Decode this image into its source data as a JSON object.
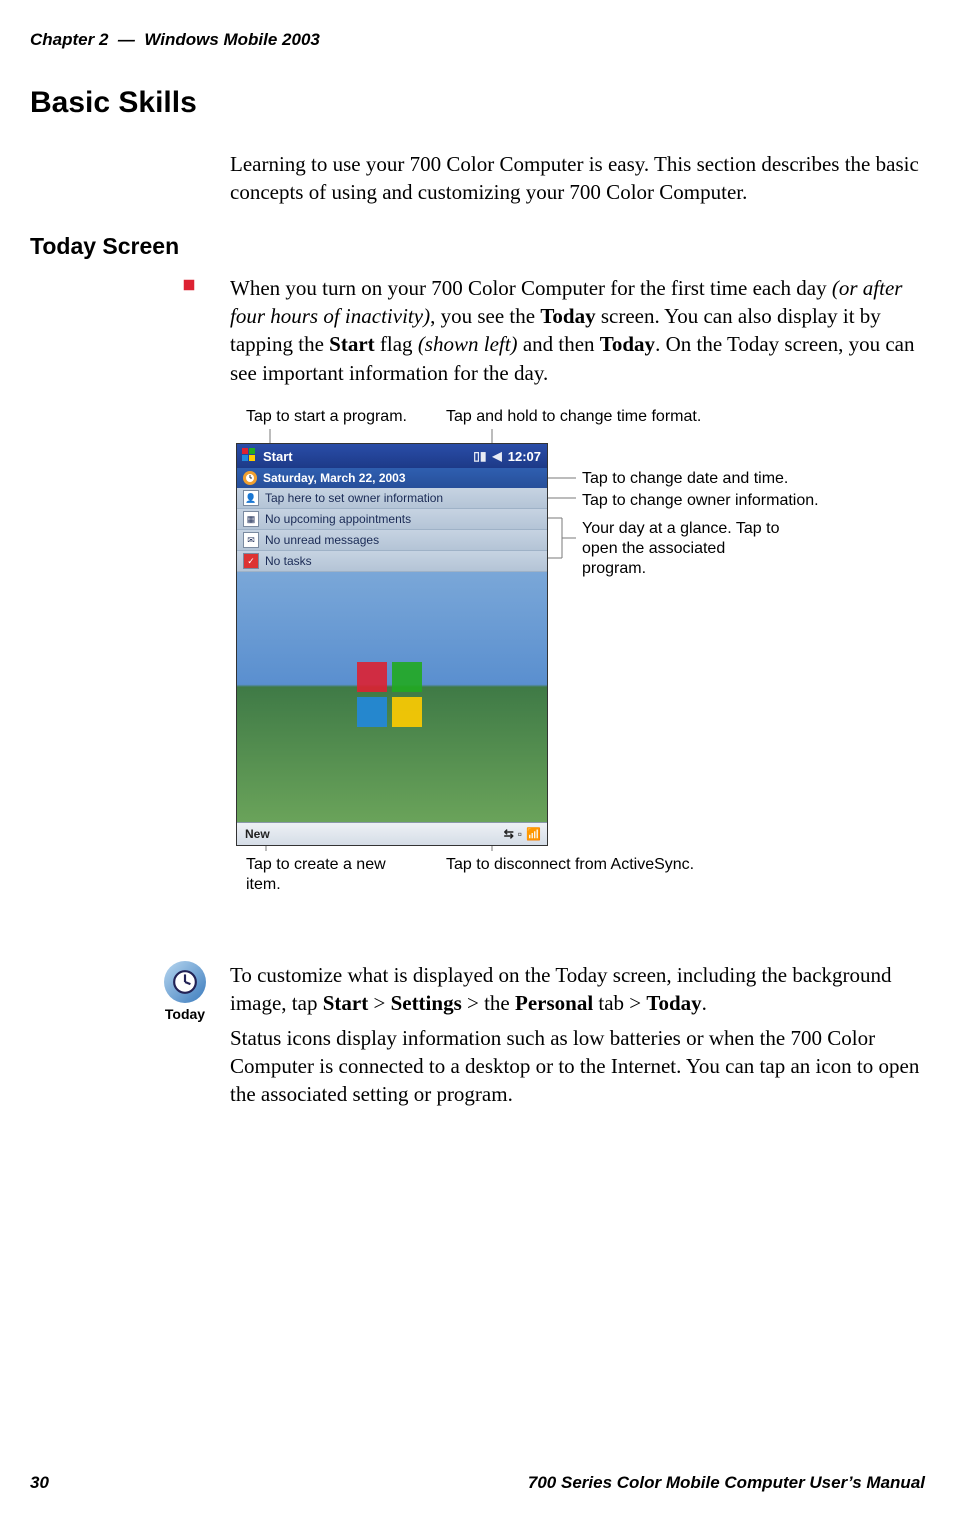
{
  "header": {
    "chapter_label": "Chapter 2",
    "separator": "—",
    "topic": "Windows Mobile 2003"
  },
  "h1": "Basic Skills",
  "intro": "Learning to use your 700 Color Computer is easy. This section describes the basic concepts of using and customizing your 700 Color Computer.",
  "h2": "Today Screen",
  "today_para_parts": {
    "a": "When you turn on your 700 Color Computer for the first time each day ",
    "b_em": "(or after four hours of inactivity)",
    "c": ", you see the ",
    "d_strong": "Today",
    "e": " screen. You can also display it by tapping the ",
    "f_strong": "Start",
    "g": " flag ",
    "h_em": "(shown left)",
    "i": " and then ",
    "j_strong": "Today",
    "k": ". On the Today screen, you can see important information for the day."
  },
  "callouts": {
    "start_program": "Tap to start a program.",
    "time_format": "Tap and hold to change time format.",
    "date_time": "Tap to change date and time.",
    "owner_info": "Tap to change owner information.",
    "glance": "Your day at a glance. Tap to open the associated program.",
    "new_item": "Tap to create a new item.",
    "activesync": "Tap to disconnect from ActiveSync."
  },
  "device": {
    "start_label": "Start",
    "clock": "12:07",
    "date": "Saturday, March 22, 2003",
    "rows": {
      "owner": "Tap here to set owner information",
      "appts": "No upcoming appointments",
      "msgs": "No unread messages",
      "tasks": "No tasks"
    },
    "new_button": "New"
  },
  "today_icon_label": "Today",
  "customize_parts": {
    "a": "To customize what is displayed on the Today screen, including the back­ground image, tap ",
    "b_strong": "Start",
    "c": " > ",
    "d_strong": "Settings",
    "e": " > the ",
    "f_strong": "Personal",
    "g": " tab > ",
    "h_strong": "Today",
    "i": "."
  },
  "status_para": "Status icons display information such as low batteries or when the 700 Color Computer is connected to a desktop or to the Internet. You can tap an icon to open the associated setting or program.",
  "footer": {
    "page": "30",
    "title": "700 Series Color Mobile Computer User’s Manual"
  }
}
